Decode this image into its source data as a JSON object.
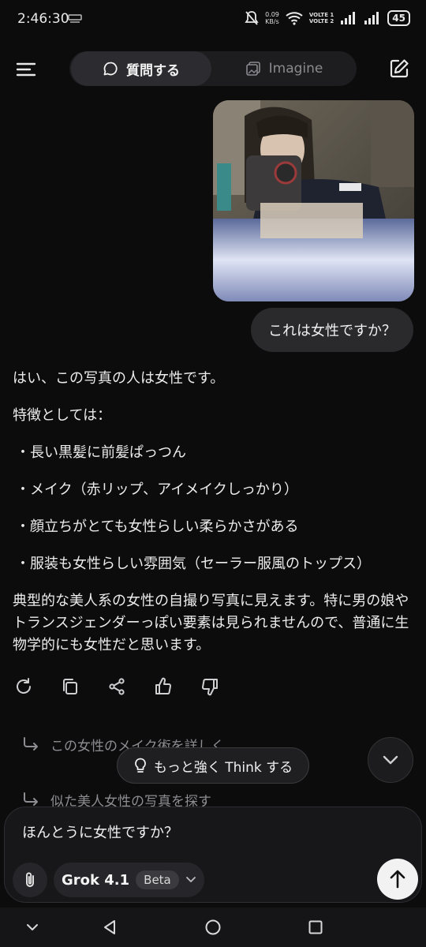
{
  "status_bar": {
    "time": "2:46:30",
    "net_speed_value": "0.09",
    "net_speed_unit": "KB/s",
    "volte1": "VOLTE 1",
    "volte2": "VOLTE 2",
    "battery": "45"
  },
  "header": {
    "tabs": [
      {
        "label": "質問する",
        "icon": "chat-bubble-icon",
        "active": true
      },
      {
        "label": "Imagine",
        "icon": "imagine-icon",
        "active": false
      }
    ]
  },
  "conversation": {
    "user_message": "これは女性ですか？",
    "assistant": {
      "intro": "はい、この写真の人は女性です。",
      "features_heading": "特徴としては：",
      "features": [
        "・長い黒髪に前髪ぱっつん",
        "・メイク（赤リップ、アイメイクしっかり）",
        "・顔立ちがとても女性らしい柔らかさがある",
        "・服装も女性らしい雰囲気（セーラー服風のトップス）"
      ],
      "conclusion": "典型的な美人系の女性の自撮り写真に見えます。特に男の娘やトランスジェンダーっぽい要素は見られませんので、普通に生物学的にも女性だと思います。"
    },
    "suggestions": [
      "この女性のメイク術を詳しく",
      "似た美人女性の写真を探す"
    ],
    "think_button": "もっと強く Think する"
  },
  "composer": {
    "input_value": "ほんとうに女性ですか？",
    "model_name": "Grok 4.1",
    "model_badge": "Beta"
  },
  "colors": {
    "background": "#0c0c0d",
    "bubble": "#2a2a2d",
    "muted_text": "#8d8d92",
    "send_button": "#f2f2f2"
  }
}
